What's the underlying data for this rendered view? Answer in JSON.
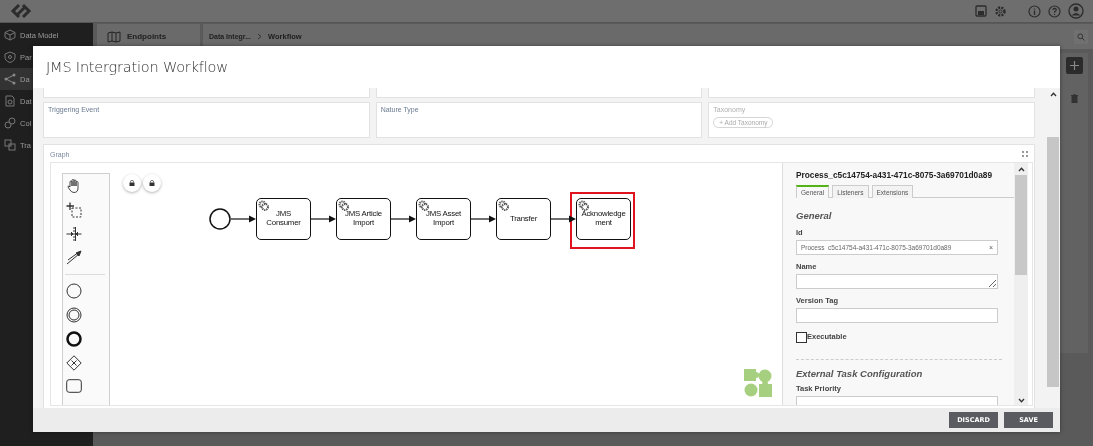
{
  "sidebar": {
    "items": [
      {
        "label": "Data Model",
        "selected": false
      },
      {
        "label": "Par",
        "selected": false
      },
      {
        "label": "Da",
        "selected": true
      },
      {
        "label": "Dat",
        "selected": false
      },
      {
        "label": "Col",
        "selected": false
      },
      {
        "label": "Tra",
        "selected": false
      }
    ]
  },
  "panel": {
    "title": "Endpoints"
  },
  "breadcrumb": [
    {
      "label": "Data Integr..."
    },
    {
      "label": "Workflow"
    }
  ],
  "modal": {
    "title": "JMS Intergration Workflow",
    "fields": [
      {
        "label": "Triggering Event"
      },
      {
        "label": "Nature Type"
      },
      {
        "label": "Taxonomy",
        "action": "+ Add Taxonomy"
      }
    ],
    "graph": {
      "label": "Graph",
      "nodes": [
        {
          "label": "JMS Consumer",
          "highlighted": false
        },
        {
          "label": "JMS Article Import",
          "highlighted": false
        },
        {
          "label": "JMS Asset Import",
          "highlighted": false
        },
        {
          "label": "Transfer",
          "highlighted": false
        },
        {
          "label": "Acknowledgement",
          "highlighted": true
        }
      ]
    },
    "properties": {
      "title": "Process_c5c14754-a431-471c-8075-3a69701d0a89",
      "tabs": [
        {
          "label": "General",
          "selected": true
        },
        {
          "label": "Listeners",
          "selected": false
        },
        {
          "label": "Extensions",
          "selected": false
        }
      ],
      "sections": [
        {
          "title": "General",
          "fields": [
            {
              "kind": "text",
              "label": "Id",
              "value": "Process_c5c14754-a431-471c-8075-3a69701d0a89",
              "clear": "×"
            },
            {
              "kind": "textarea",
              "label": "Name"
            },
            {
              "kind": "text",
              "label": "Version Tag"
            },
            {
              "kind": "checkbox",
              "label": "Executable",
              "checked": false
            }
          ]
        },
        {
          "title": "External Task Configuration",
          "fields": [
            {
              "kind": "text",
              "label": "Task Priority"
            }
          ]
        }
      ]
    },
    "buttons": [
      {
        "label": "DISCARD"
      },
      {
        "label": "SAVE"
      }
    ]
  }
}
